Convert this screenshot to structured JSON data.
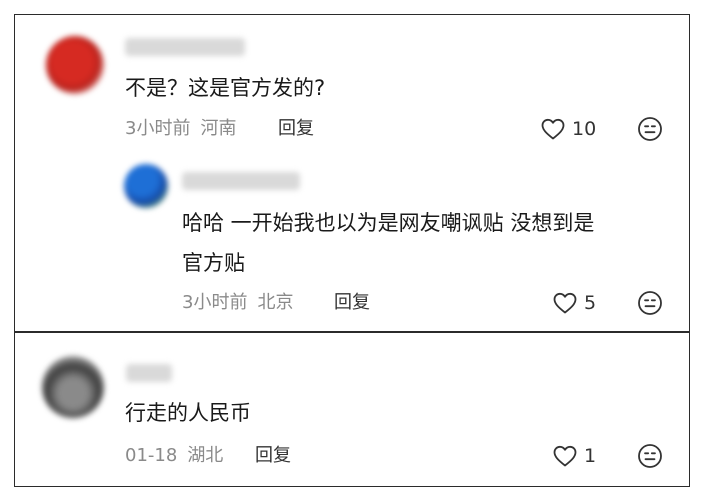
{
  "comments": [
    {
      "text": "不是？这是官方发的?",
      "time": "3小时前",
      "region": "河南",
      "reply_label": "回复",
      "likes": "10",
      "icons": {
        "like": "heart-outline-icon",
        "react": "emoji-face-icon"
      }
    },
    {
      "text_line1": "哈哈 一开始我也以为是网友嘲讽贴 没想到是",
      "text_line2": "官方贴",
      "time": "3小时前",
      "region": "北京",
      "reply_label": "回复",
      "likes": "5"
    },
    {
      "text": "行走的人民币",
      "time": "01-18",
      "region": "湖北",
      "reply_label": "回复",
      "likes": "1"
    }
  ]
}
